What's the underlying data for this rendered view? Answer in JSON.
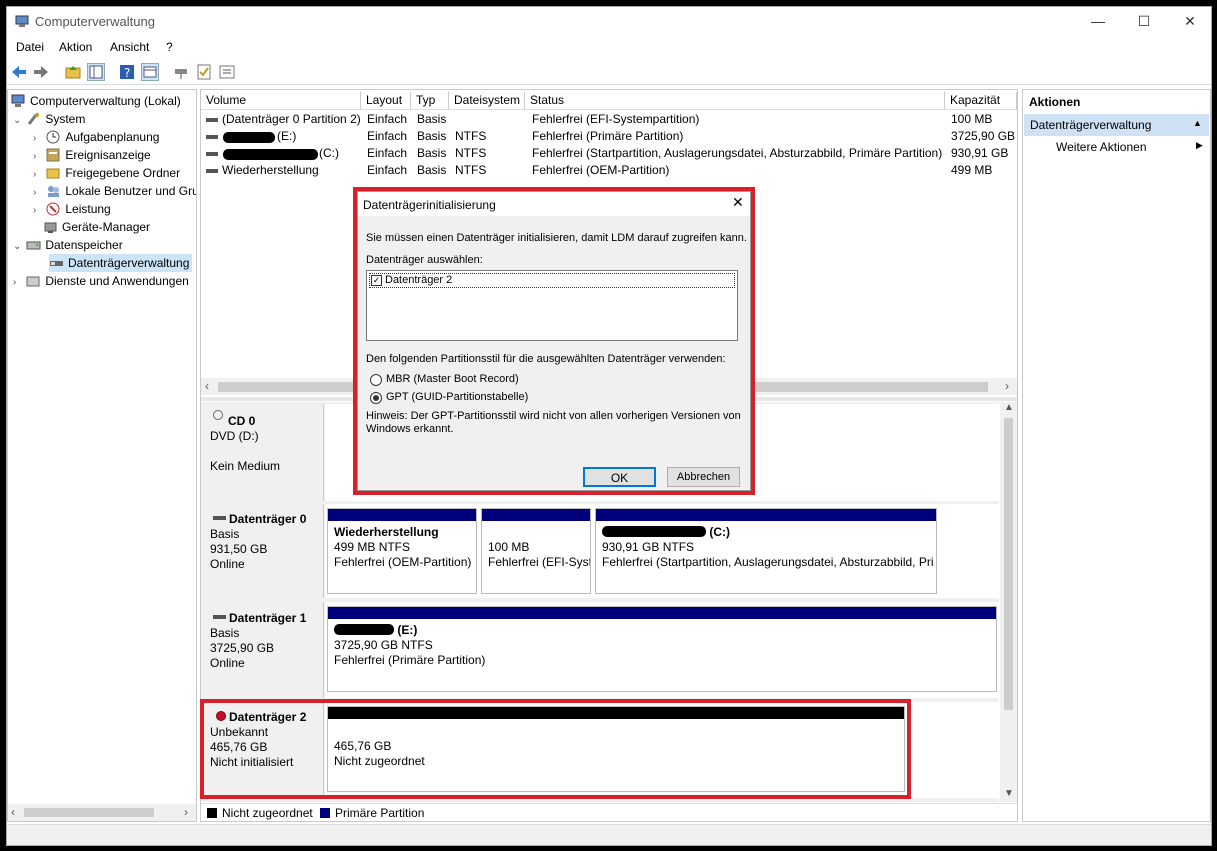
{
  "window": {
    "title": "Computerverwaltung",
    "minimize_glyph": "—",
    "maximize_glyph": "☐",
    "close_glyph": "✕"
  },
  "menu": [
    "Datei",
    "Aktion",
    "Ansicht",
    "?"
  ],
  "tree": {
    "root": "Computerverwaltung (Lokal)",
    "system": "System",
    "aufgaben": "Aufgabenplanung",
    "ereignis": "Ereignisanzeige",
    "freigabe": "Freigegebene Ordner",
    "benutzer": "Lokale Benutzer und Gruppen",
    "leistung": "Leistung",
    "geraete": "Geräte-Manager",
    "datenspeicher": "Datenspeicher",
    "dtverw": "Datenträgerverwaltung",
    "dienste": "Dienste und Anwendungen"
  },
  "volumes": {
    "headers": [
      "Volume",
      "Layout",
      "Typ",
      "Dateisystem",
      "Status",
      "Kapazität"
    ],
    "rows": [
      {
        "volume": "(Datenträger 0 Partition 2)",
        "layout": "Einfach",
        "typ": "Basis",
        "fs": "",
        "status": "Fehlerfrei (EFI-Systempartition)",
        "kap": "100 MB"
      },
      {
        "volume": "(E:)",
        "layout": "Einfach",
        "typ": "Basis",
        "fs": "NTFS",
        "status": "Fehlerfrei (Primäre Partition)",
        "kap": "3725,90 GB"
      },
      {
        "volume": "(C:)",
        "layout": "Einfach",
        "typ": "Basis",
        "fs": "NTFS",
        "status": "Fehlerfrei (Startpartition, Auslagerungsdatei, Absturzabbild, Primäre Partition)",
        "kap": "930,91 GB"
      },
      {
        "volume": "Wiederherstellung",
        "layout": "Einfach",
        "typ": "Basis",
        "fs": "NTFS",
        "status": "Fehlerfrei (OEM-Partition)",
        "kap": "499 MB"
      }
    ]
  },
  "disks": {
    "cd0": {
      "name": "CD 0",
      "type": "DVD (D:)",
      "state": "Kein Medium"
    },
    "d0": {
      "name": "Datenträger 0",
      "type": "Basis",
      "size": "931,50 GB",
      "state": "Online",
      "p1": {
        "name": "Wiederherstellung",
        "size": "499 MB NTFS",
        "status": "Fehlerfrei (OEM-Partition)"
      },
      "p2": {
        "size": "100 MB",
        "status": "Fehlerfrei (EFI-Syst"
      },
      "p3": {
        "name": "(C:)",
        "size": "930,91 GB NTFS",
        "status": "Fehlerfrei (Startpartition, Auslagerungsdatei, Absturzabbild, Pri"
      }
    },
    "d1": {
      "name": "Datenträger 1",
      "type": "Basis",
      "size": "3725,90 GB",
      "state": "Online",
      "p1": {
        "name": "(E:)",
        "size": "3725,90 GB NTFS",
        "status": "Fehlerfrei (Primäre Partition)"
      }
    },
    "d2": {
      "name": "Datenträger 2",
      "type": "Unbekannt",
      "size": "465,76 GB",
      "state": "Nicht initialisiert",
      "p1": {
        "size": "465,76 GB",
        "status": "Nicht zugeordnet"
      }
    }
  },
  "legend": {
    "unallocated": "Nicht zugeordnet",
    "primary": "Primäre Partition"
  },
  "actions": {
    "title": "Aktionen",
    "section": "Datenträgerverwaltung",
    "more": "Weitere Aktionen"
  },
  "dialog": {
    "title": "Datenträgerinitialisierung",
    "intro": "Sie müssen einen Datenträger initialisieren, damit LDM darauf zugreifen kann.",
    "select_label": "Datenträger auswählen:",
    "disk_item": "Datenträger 2",
    "style_label": "Den folgenden Partitionsstil für die ausgewählten Datenträger verwenden:",
    "mbr": "MBR (Master Boot Record)",
    "gpt": "GPT (GUID-Partitionstabelle)",
    "hint1": "Hinweis: Der GPT-Partitionsstil wird nicht von allen vorherigen Versionen von",
    "hint2": "Windows erkannt.",
    "ok": "OK",
    "cancel": "Abbrechen"
  },
  "colors": {
    "primary_bar": "#00007b",
    "highlight": "#cce4f7",
    "annotation": "#d7212a"
  }
}
